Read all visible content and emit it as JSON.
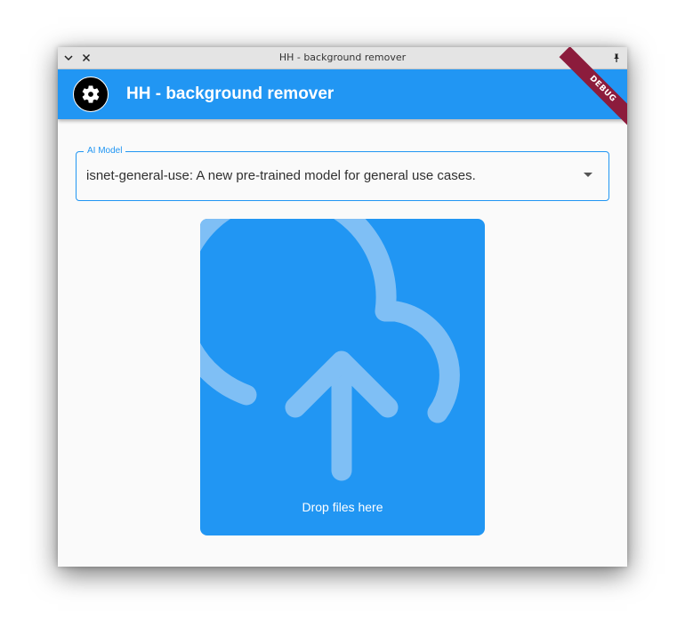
{
  "window": {
    "title": "HH - background remover"
  },
  "appbar": {
    "title": "HH - background remover",
    "debug_banner": "DEBUG"
  },
  "model_field": {
    "label": "AI Model",
    "value": "isnet-general-use: A new pre-trained model for general use cases."
  },
  "dropzone": {
    "label": "Drop files here"
  },
  "colors": {
    "primary": "#2196f3",
    "debug_ribbon": "#8c1c3c",
    "icon_tint": "#7fbff5"
  },
  "icons": {
    "titlebar_left": [
      "chevron-down-icon",
      "close-icon"
    ],
    "titlebar_right": "pin-icon",
    "avatar": "gear-icon",
    "dropzone": "cloud-upload-icon",
    "dropdown": "caret-down-icon"
  }
}
